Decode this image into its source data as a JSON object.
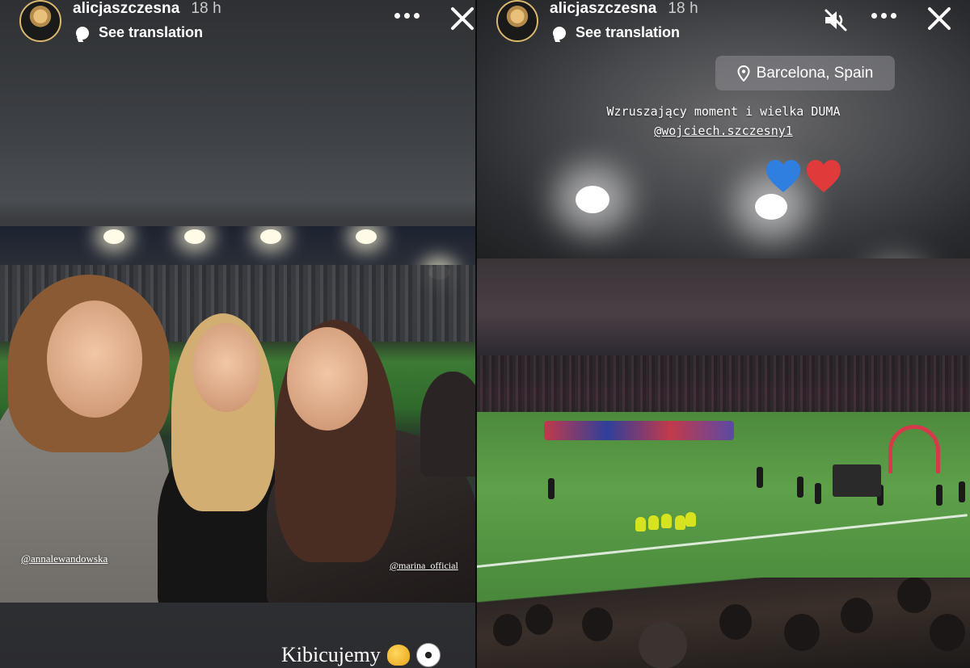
{
  "stories": [
    {
      "username": "alicjaszczesna",
      "time_ago": "18 h",
      "translate_label": "See translation",
      "tags": [
        "@annalewandowska",
        "@marina_official"
      ],
      "caption": "Kibicujemy",
      "caption_emoji": [
        "flexed-biceps-emoji",
        "soccer-ball-emoji"
      ]
    },
    {
      "username": "alicjaszczesna",
      "time_ago": "18 h",
      "translate_label": "See translation",
      "location": "Barcelona, Spain",
      "caption_line1": "Wzruszający moment i wielka DUMA",
      "caption_mention": "@wojciech.szczesny1",
      "caption_emoji": [
        "blue-heart-emoji",
        "red-heart-emoji"
      ]
    }
  ],
  "icons": [
    "more-icon",
    "close-icon",
    "mute-icon",
    "location-pin-icon"
  ],
  "colors": {
    "heart_blue": "#2f7fe0",
    "heart_red": "#e03a3a",
    "sticker_bg": "#8c8c91"
  }
}
